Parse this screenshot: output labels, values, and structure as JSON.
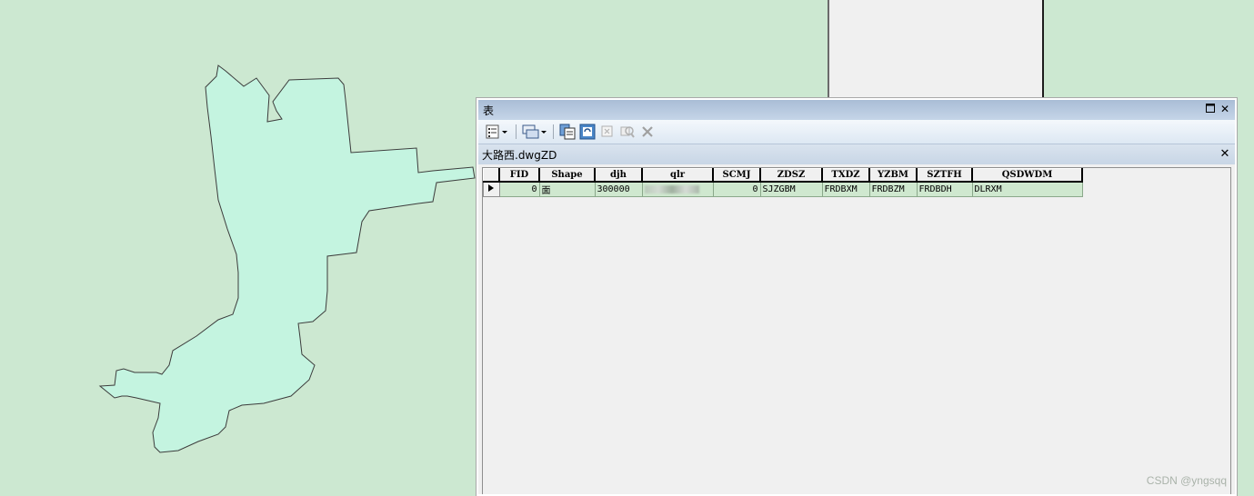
{
  "window": {
    "title": "表"
  },
  "toolbar": {
    "icons": [
      "table-options-icon",
      "related-tables-icon",
      "select-by-attributes-icon",
      "switch-selection-icon",
      "clear-selection-icon",
      "zoom-to-selected-icon",
      "delete-selected-icon"
    ]
  },
  "tab": {
    "label": "大路西.dwgZD"
  },
  "table": {
    "columns": [
      "FID",
      "Shape",
      "djh",
      "qlr",
      "SCMJ",
      "ZDSZ",
      "TXDZ",
      "YZBM",
      "SZTFH",
      "QSDWDM"
    ],
    "rows": [
      {
        "FID": "0",
        "Shape": "面",
        "djh": "300000",
        "qlr": "",
        "SCMJ": "0",
        "ZDSZ": "SJZGBM",
        "TXDZ": "FRDBXM",
        "YZBM": "FRDBZM",
        "SZTFH": "FRDBDH",
        "QSDWDM": "DLRXM"
      }
    ]
  },
  "colors": {
    "map_bg": "#cce8d1",
    "polygon_fill": "#c4f4e0",
    "row_fill": "#cfe8cf"
  },
  "watermark": "CSDN @yngsqq"
}
